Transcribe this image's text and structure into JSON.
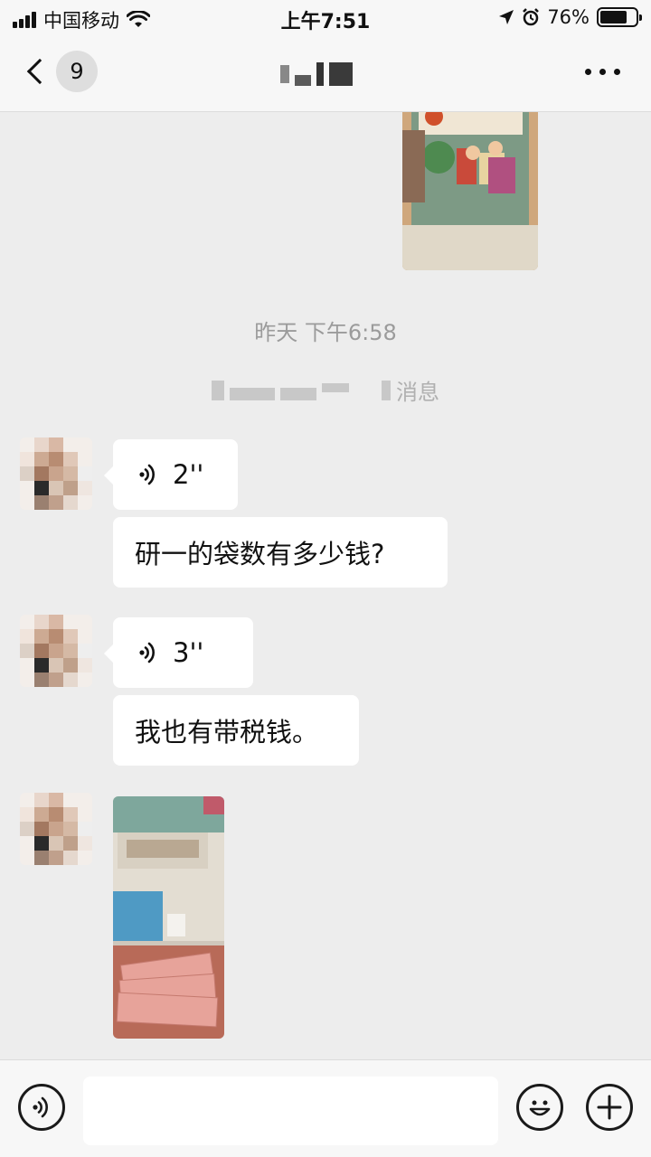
{
  "status_bar": {
    "carrier": "中国移动",
    "time": "上午7:51",
    "battery_percent": "76%",
    "battery_level": 0.76
  },
  "nav": {
    "unread_count": "9"
  },
  "chat": {
    "timestamp": "昨天 下午6:58",
    "system_message_visible_fragment": "消息",
    "messages": [
      {
        "type": "voice",
        "duration": "2''"
      },
      {
        "type": "text",
        "text": "研一的袋数有多少钱?"
      },
      {
        "type": "voice",
        "duration": "3''"
      },
      {
        "type": "text",
        "text": "我也有带税钱。"
      },
      {
        "type": "image"
      }
    ]
  },
  "input": {
    "placeholder": ""
  },
  "icons": {
    "voice": "voice-wave-icon",
    "emoji": "smile-face-icon",
    "plus": "plus-circle-icon",
    "more": "ellipsis-icon",
    "back": "chevron-left-icon"
  }
}
